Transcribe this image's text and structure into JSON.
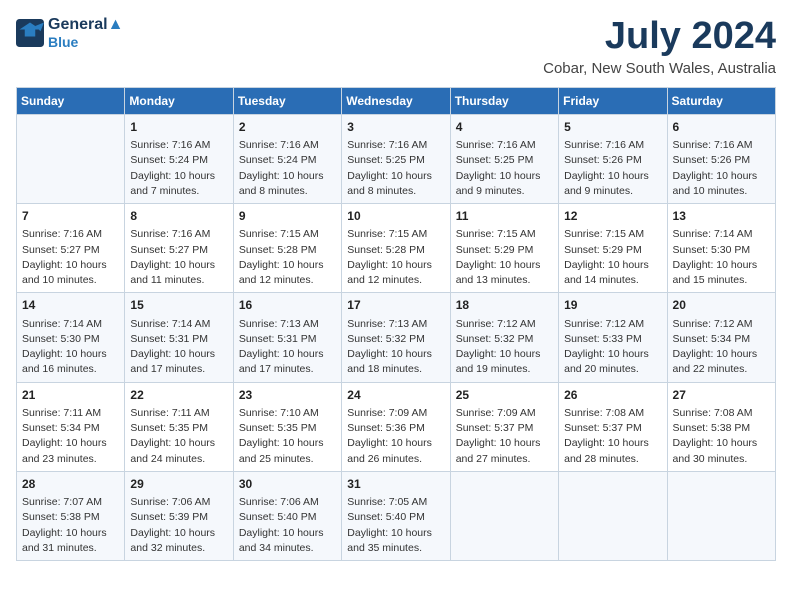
{
  "logo": {
    "line1": "General",
    "line2": "Blue"
  },
  "title": "July 2024",
  "subtitle": "Cobar, New South Wales, Australia",
  "headers": [
    "Sunday",
    "Monday",
    "Tuesday",
    "Wednesday",
    "Thursday",
    "Friday",
    "Saturday"
  ],
  "weeks": [
    [
      {
        "day": "",
        "info": ""
      },
      {
        "day": "1",
        "info": "Sunrise: 7:16 AM\nSunset: 5:24 PM\nDaylight: 10 hours\nand 7 minutes."
      },
      {
        "day": "2",
        "info": "Sunrise: 7:16 AM\nSunset: 5:24 PM\nDaylight: 10 hours\nand 8 minutes."
      },
      {
        "day": "3",
        "info": "Sunrise: 7:16 AM\nSunset: 5:25 PM\nDaylight: 10 hours\nand 8 minutes."
      },
      {
        "day": "4",
        "info": "Sunrise: 7:16 AM\nSunset: 5:25 PM\nDaylight: 10 hours\nand 9 minutes."
      },
      {
        "day": "5",
        "info": "Sunrise: 7:16 AM\nSunset: 5:26 PM\nDaylight: 10 hours\nand 9 minutes."
      },
      {
        "day": "6",
        "info": "Sunrise: 7:16 AM\nSunset: 5:26 PM\nDaylight: 10 hours\nand 10 minutes."
      }
    ],
    [
      {
        "day": "7",
        "info": "Sunrise: 7:16 AM\nSunset: 5:27 PM\nDaylight: 10 hours\nand 10 minutes."
      },
      {
        "day": "8",
        "info": "Sunrise: 7:16 AM\nSunset: 5:27 PM\nDaylight: 10 hours\nand 11 minutes."
      },
      {
        "day": "9",
        "info": "Sunrise: 7:15 AM\nSunset: 5:28 PM\nDaylight: 10 hours\nand 12 minutes."
      },
      {
        "day": "10",
        "info": "Sunrise: 7:15 AM\nSunset: 5:28 PM\nDaylight: 10 hours\nand 12 minutes."
      },
      {
        "day": "11",
        "info": "Sunrise: 7:15 AM\nSunset: 5:29 PM\nDaylight: 10 hours\nand 13 minutes."
      },
      {
        "day": "12",
        "info": "Sunrise: 7:15 AM\nSunset: 5:29 PM\nDaylight: 10 hours\nand 14 minutes."
      },
      {
        "day": "13",
        "info": "Sunrise: 7:14 AM\nSunset: 5:30 PM\nDaylight: 10 hours\nand 15 minutes."
      }
    ],
    [
      {
        "day": "14",
        "info": "Sunrise: 7:14 AM\nSunset: 5:30 PM\nDaylight: 10 hours\nand 16 minutes."
      },
      {
        "day": "15",
        "info": "Sunrise: 7:14 AM\nSunset: 5:31 PM\nDaylight: 10 hours\nand 17 minutes."
      },
      {
        "day": "16",
        "info": "Sunrise: 7:13 AM\nSunset: 5:31 PM\nDaylight: 10 hours\nand 17 minutes."
      },
      {
        "day": "17",
        "info": "Sunrise: 7:13 AM\nSunset: 5:32 PM\nDaylight: 10 hours\nand 18 minutes."
      },
      {
        "day": "18",
        "info": "Sunrise: 7:12 AM\nSunset: 5:32 PM\nDaylight: 10 hours\nand 19 minutes."
      },
      {
        "day": "19",
        "info": "Sunrise: 7:12 AM\nSunset: 5:33 PM\nDaylight: 10 hours\nand 20 minutes."
      },
      {
        "day": "20",
        "info": "Sunrise: 7:12 AM\nSunset: 5:34 PM\nDaylight: 10 hours\nand 22 minutes."
      }
    ],
    [
      {
        "day": "21",
        "info": "Sunrise: 7:11 AM\nSunset: 5:34 PM\nDaylight: 10 hours\nand 23 minutes."
      },
      {
        "day": "22",
        "info": "Sunrise: 7:11 AM\nSunset: 5:35 PM\nDaylight: 10 hours\nand 24 minutes."
      },
      {
        "day": "23",
        "info": "Sunrise: 7:10 AM\nSunset: 5:35 PM\nDaylight: 10 hours\nand 25 minutes."
      },
      {
        "day": "24",
        "info": "Sunrise: 7:09 AM\nSunset: 5:36 PM\nDaylight: 10 hours\nand 26 minutes."
      },
      {
        "day": "25",
        "info": "Sunrise: 7:09 AM\nSunset: 5:37 PM\nDaylight: 10 hours\nand 27 minutes."
      },
      {
        "day": "26",
        "info": "Sunrise: 7:08 AM\nSunset: 5:37 PM\nDaylight: 10 hours\nand 28 minutes."
      },
      {
        "day": "27",
        "info": "Sunrise: 7:08 AM\nSunset: 5:38 PM\nDaylight: 10 hours\nand 30 minutes."
      }
    ],
    [
      {
        "day": "28",
        "info": "Sunrise: 7:07 AM\nSunset: 5:38 PM\nDaylight: 10 hours\nand 31 minutes."
      },
      {
        "day": "29",
        "info": "Sunrise: 7:06 AM\nSunset: 5:39 PM\nDaylight: 10 hours\nand 32 minutes."
      },
      {
        "day": "30",
        "info": "Sunrise: 7:06 AM\nSunset: 5:40 PM\nDaylight: 10 hours\nand 34 minutes."
      },
      {
        "day": "31",
        "info": "Sunrise: 7:05 AM\nSunset: 5:40 PM\nDaylight: 10 hours\nand 35 minutes."
      },
      {
        "day": "",
        "info": ""
      },
      {
        "day": "",
        "info": ""
      },
      {
        "day": "",
        "info": ""
      }
    ]
  ]
}
